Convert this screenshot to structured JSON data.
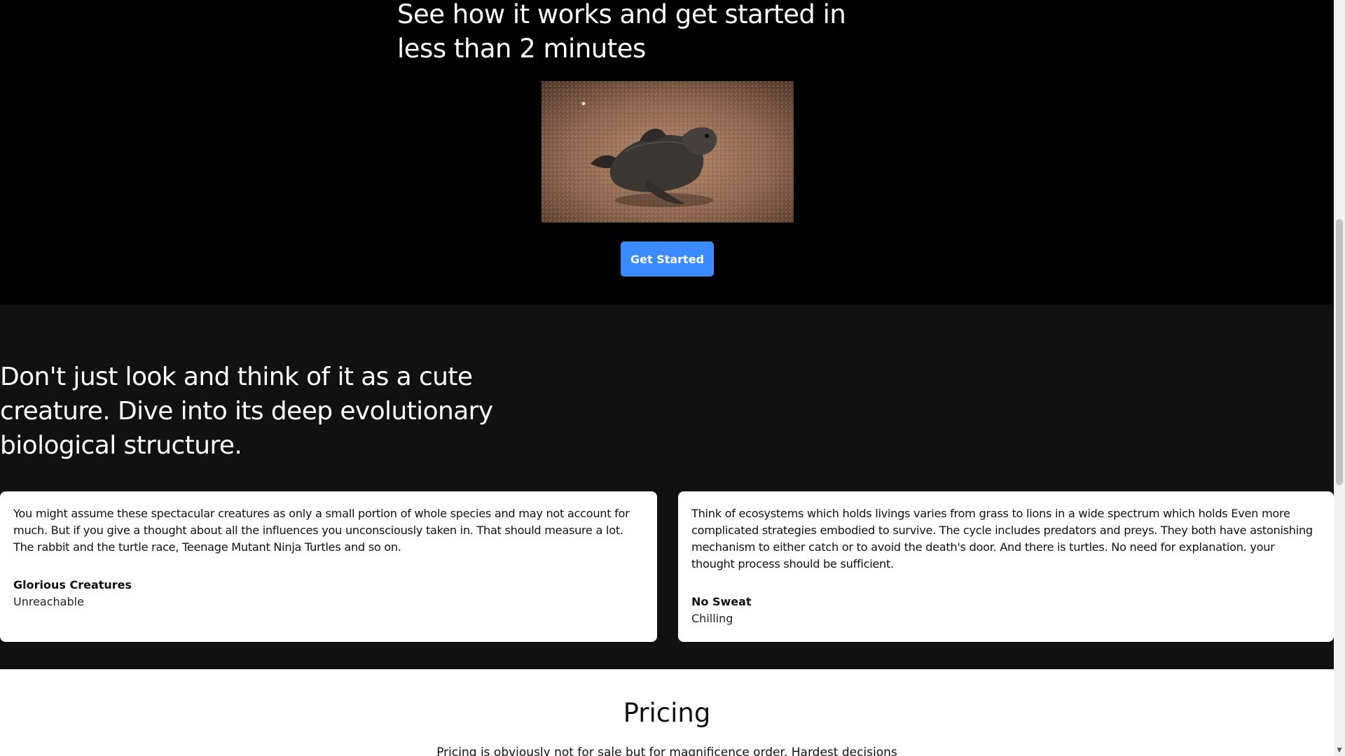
{
  "hero": {
    "title": "See how it works and get started in less than 2 minutes",
    "image_alt": "baby sea turtle crawling on sand",
    "cta_label": "Get Started",
    "cta_color": "#3b8aff"
  },
  "features": {
    "title": "Don't just look and think of it as a cute creature. Dive into its deep evolutionary biological structure.",
    "cards": [
      {
        "text": "You might assume these spectacular creatures as only a small portion of whole species and may not account for much. But if you give a thought about all the influences you unconsciously taken in. That should measure a lot. The rabbit and the turtle race, Teenage Mutant Ninja Turtles and so on.",
        "name": "Glorious Creatures",
        "role": "Unreachable"
      },
      {
        "text": "Think of ecosystems which holds livings varies from grass to lions in a wide spectrum which holds Even more complicated strategies embodied to survive. The cycle includes predators and preys. They both have astonishing mechanism to either catch or to avoid the death's door. And there is turtles. No need for explanation. your thought process should be sufficient.",
        "name": "No Sweat",
        "role": "Chilling"
      }
    ]
  },
  "pricing": {
    "title": "Pricing",
    "text": "Pricing is obviously not for sale but for magnificence order. Hardest decisions"
  },
  "colors": {
    "hero_bg": "#000000",
    "features_bg": "#111111",
    "card_bg": "#ffffff",
    "pricing_bg": "#ffffff"
  },
  "icons": {
    "scroll_down": "chevron-down-icon"
  }
}
